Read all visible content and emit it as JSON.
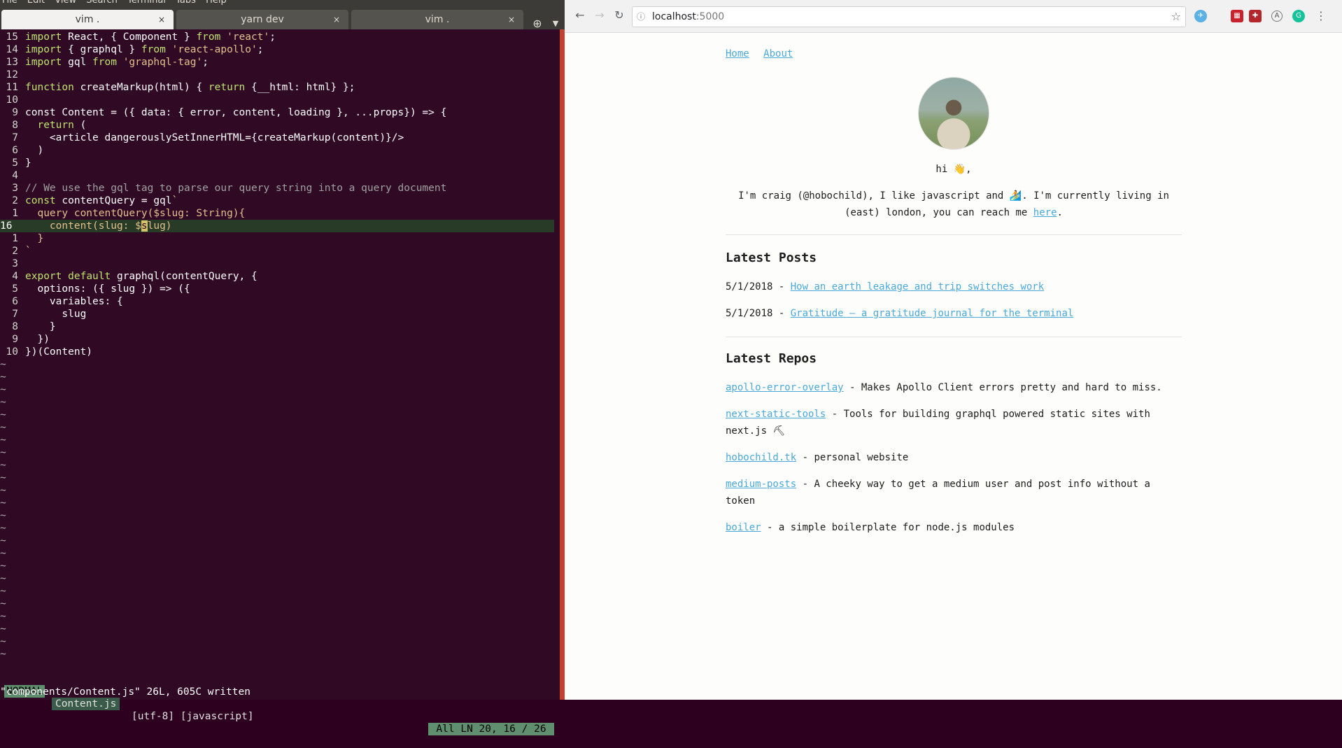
{
  "terminal": {
    "menu": [
      "File",
      "Edit",
      "View",
      "Search",
      "Terminal",
      "Tabs",
      "Help"
    ],
    "tabs": [
      {
        "label": "vim .",
        "active": true
      },
      {
        "label": "yarn dev",
        "active": false
      },
      {
        "label": "vim .",
        "active": false
      }
    ],
    "tab_close_glyph": "×",
    "lines": [
      {
        "ln": "15",
        "code": "import React, { Component } from 'react';"
      },
      {
        "ln": "14",
        "code": "import { graphql } from 'react-apollo';"
      },
      {
        "ln": "13",
        "code": "import gql from 'graphql-tag';"
      },
      {
        "ln": "12",
        "code": ""
      },
      {
        "ln": "11",
        "code": "function createMarkup(html) { return {__html: html} };"
      },
      {
        "ln": "10",
        "code": ""
      },
      {
        "ln": "9",
        "code": "const Content = ({ data: { error, content, loading }, ...props}) => {"
      },
      {
        "ln": "8",
        "code": "  return ("
      },
      {
        "ln": "7",
        "code": "    <article dangerouslySetInnerHTML={createMarkup(content)}/>"
      },
      {
        "ln": "6",
        "code": "  )"
      },
      {
        "ln": "5",
        "code": "}"
      },
      {
        "ln": "4",
        "code": ""
      },
      {
        "ln": "3",
        "code": "// We use the gql tag to parse our query string into a query document"
      },
      {
        "ln": "2",
        "code": "const contentQuery = gql`"
      },
      {
        "ln": "1",
        "code": "  query contentQuery($slug: String){"
      },
      {
        "ln": "16",
        "code": "    content(slug: $slug)"
      },
      {
        "ln": "1",
        "code": "  }"
      },
      {
        "ln": "2",
        "code": "`"
      },
      {
        "ln": "3",
        "code": ""
      },
      {
        "ln": "4",
        "code": "export default graphql(contentQuery, {"
      },
      {
        "ln": "5",
        "code": "  options: ({ slug }) => ({"
      },
      {
        "ln": "6",
        "code": "    variables: {"
      },
      {
        "ln": "7",
        "code": "      slug"
      },
      {
        "ln": "8",
        "code": "    }"
      },
      {
        "ln": "9",
        "code": "  })"
      },
      {
        "ln": "10",
        "code": "})(Content)"
      }
    ],
    "tilde": "~",
    "status": {
      "mode": "NORMAL",
      "file": "Content.js",
      "encoding": "[utf-8] [javascript]",
      "position": "All LN 20, 16 / 26"
    },
    "cmdline": "\"components/Content.js\" 26L, 605C written"
  },
  "browser": {
    "url_host": "localhost",
    "url_port": ":5000",
    "nav": {
      "home": "Home",
      "about": "About"
    },
    "greeting": "hi 👋,",
    "intro_line1": "I'm craig (@hobochild), I like javascript and 🏄. I'm currently living in",
    "intro_line2_pre": "(east) london, you can reach me ",
    "intro_link": "here",
    "intro_line2_post": ".",
    "posts_heading": "Latest Posts",
    "posts": [
      {
        "date": "5/1/2018",
        "sep": " - ",
        "title": "How an earth leakage and trip switches work"
      },
      {
        "date": "5/1/2018",
        "sep": " - ",
        "title": "Gratitude — a gratitude journal for the terminal"
      }
    ],
    "repos_heading": "Latest Repos",
    "repos": [
      {
        "name": "apollo-error-overlay",
        "desc": " - Makes Apollo Client errors pretty and hard to miss."
      },
      {
        "name": "next-static-tools",
        "desc": " - Tools for building graphql powered static sites with next.js ⛏"
      },
      {
        "name": "hobochild.tk",
        "desc": " - personal website"
      },
      {
        "name": "medium-posts",
        "desc": " - A cheeky way to get a medium user and post info without a token"
      },
      {
        "name": "boiler",
        "desc": " - a simple boilerplate for node.js modules"
      }
    ]
  },
  "colors": {
    "terminal_bg": "#300a24",
    "cursorline": "#283b26",
    "link": "#4aa9d8",
    "ubuntu_accent": "#c2442e"
  }
}
